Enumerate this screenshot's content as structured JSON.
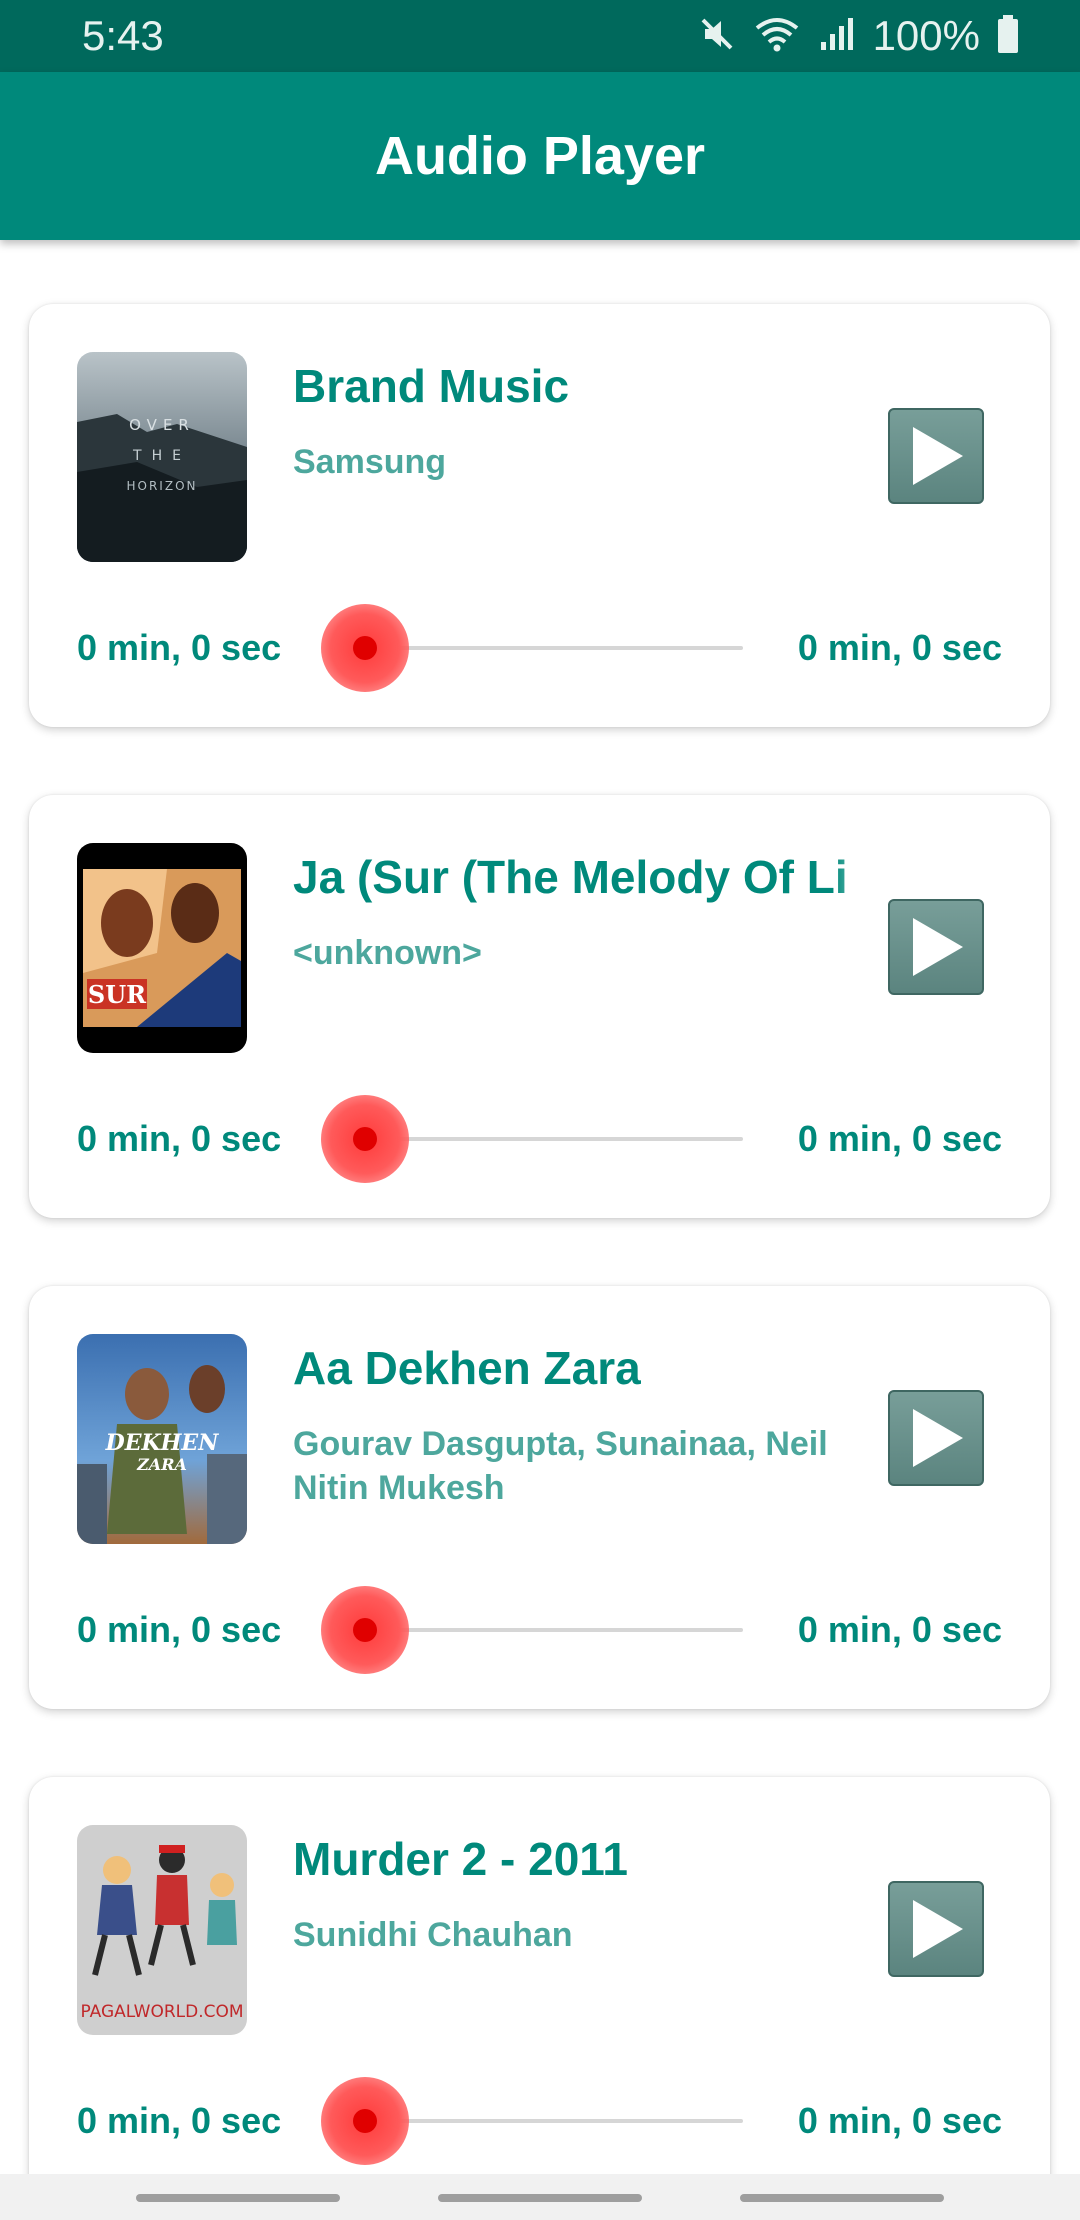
{
  "status_bar": {
    "time": "5:43",
    "battery": "100%",
    "icons": [
      "mute-icon",
      "wifi-icon",
      "signal-icon",
      "battery-icon"
    ]
  },
  "app_bar": {
    "title": "Audio Player",
    "color": "#00897b"
  },
  "tracks": [
    {
      "title": "Brand Music",
      "artist": "Samsung",
      "art_icon": "album-art-over-the-horizon",
      "art_text": "OVER THE HORIZON",
      "elapsed": "0 min, 0 sec",
      "duration": "0 min, 0 sec",
      "progress": 0
    },
    {
      "title": " Ja (Sur (The Melody Of Li",
      "artist": "<unknown>",
      "art_icon": "album-art-sur",
      "art_text": "SUR",
      "elapsed": "0 min, 0 sec",
      "duration": "0 min, 0 sec",
      "progress": 0
    },
    {
      "title": "Aa Dekhen Zara",
      "artist": "Gourav Dasgupta, Sunainaa, Neil Nitin Mukesh",
      "art_icon": "album-art-aa-dekhen-zara",
      "art_text": "AA DEKHEN ZARA",
      "elapsed": "0 min, 0 sec",
      "duration": "0 min, 0 sec",
      "progress": 0
    },
    {
      "title": "Murder 2 - 2011",
      "artist": "Sunidhi Chauhan",
      "art_icon": "album-art-pagalworld",
      "art_text": "PAGALWORLD.COM",
      "elapsed": "0 min, 0 sec",
      "duration": "0 min, 0 sec",
      "progress": 0
    }
  ],
  "colors": {
    "status_bar": "#00695c",
    "accent": "#00897b",
    "artist": "#4da79d",
    "seek_thumb": "#ff3b3b",
    "play_button": "#6a918c"
  }
}
